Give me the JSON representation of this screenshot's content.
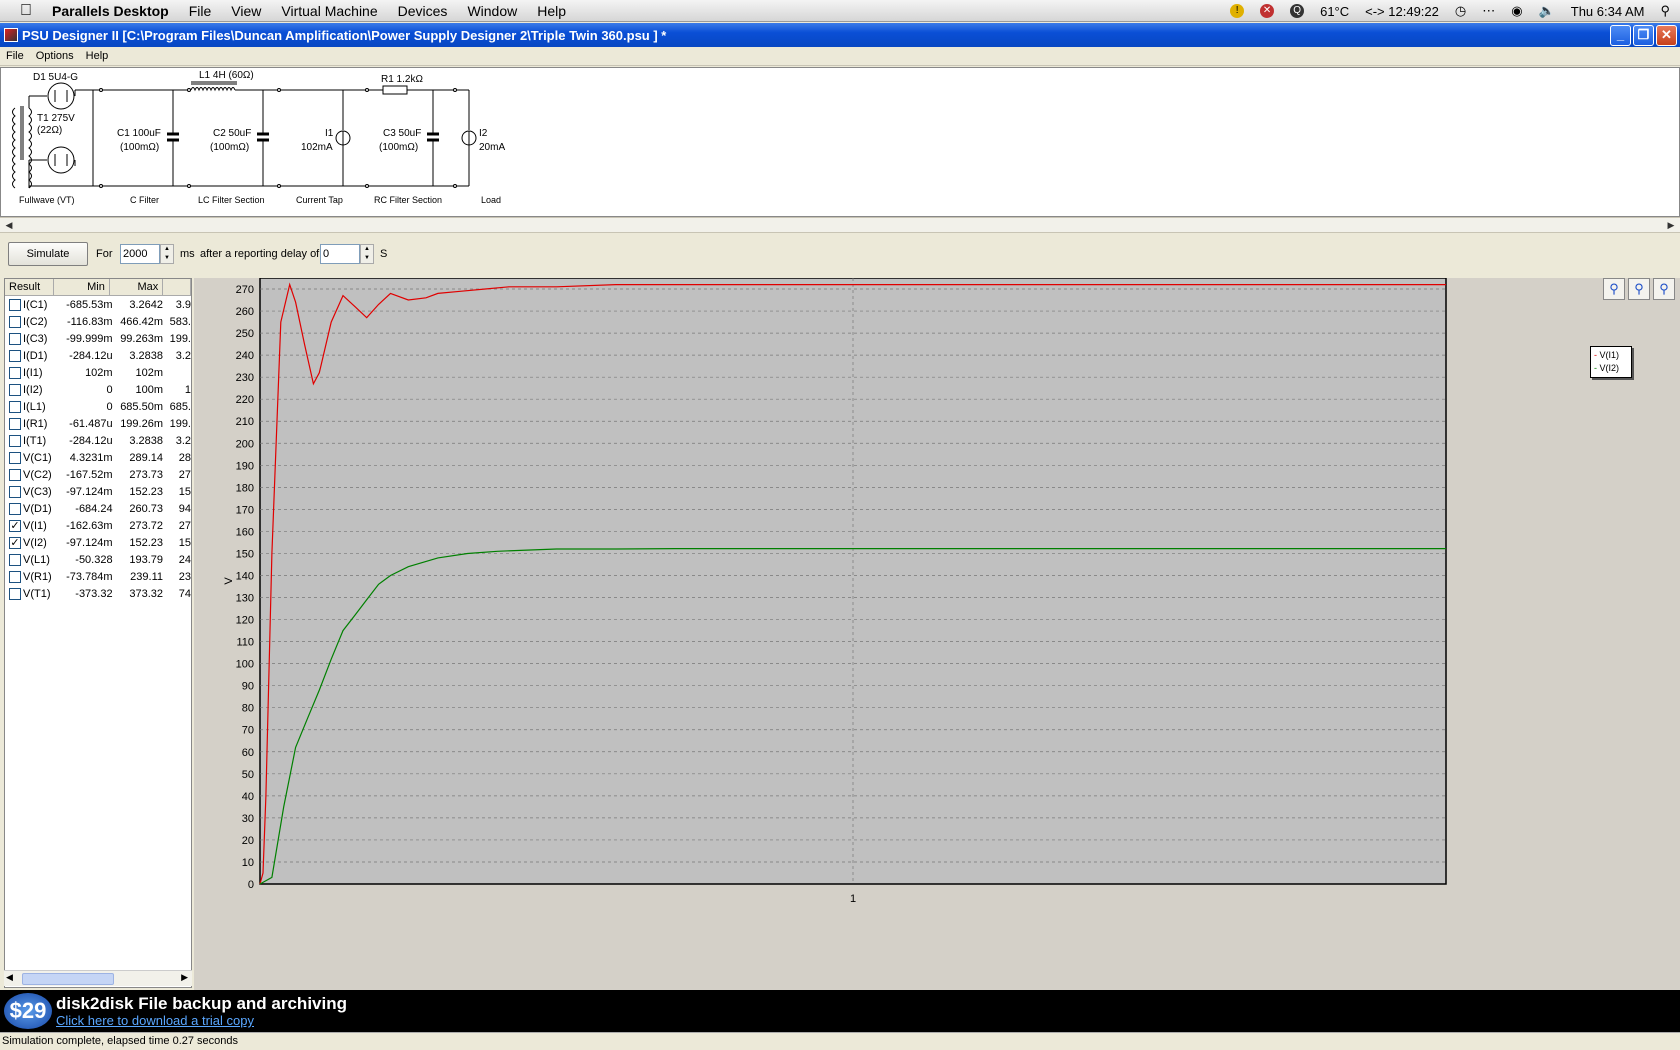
{
  "mac_menubar": {
    "app_name": "Parallels Desktop",
    "items": [
      "File",
      "View",
      "Virtual Machine",
      "Devices",
      "Window",
      "Help"
    ],
    "temperature": "61°C",
    "timer": "12:49:22",
    "clock": "Thu 6:34 AM"
  },
  "window": {
    "title": "PSU Designer II  [C:\\Program Files\\Duncan Amplification\\Power Supply Designer 2\\Triple Twin 360.psu ] *",
    "minimize": "_",
    "maximize": "❐",
    "close": "✕"
  },
  "app_menu": [
    "File",
    "Options",
    "Help"
  ],
  "schematic": {
    "d1": "D1 5U4-G",
    "t1a": "T1 275V",
    "t1b": "(22Ω)",
    "l1": "L1 4H (60Ω)",
    "r1": "R1 1.2kΩ",
    "c1a": "C1 100uF",
    "c1b": "(100mΩ)",
    "c2a": "C2 50uF",
    "c2b": "(100mΩ)",
    "i1a": "I1",
    "i1b": "102mA",
    "c3a": "C3 50uF",
    "c3b": "(100mΩ)",
    "i2a": "I2",
    "i2b": "20mA",
    "sections": [
      "Fullwave (VT)",
      "C Filter",
      "LC Filter Section",
      "Current Tap",
      "RC Filter Section",
      "Load"
    ]
  },
  "toolbar": {
    "simulate_label": "Simulate",
    "for_label": "For",
    "duration": "2000",
    "ms_label": "ms",
    "delay_label": "after a reporting delay of",
    "delay": "0",
    "s_label": "S"
  },
  "results": {
    "headers": [
      "Result",
      "Min",
      "Max",
      ""
    ],
    "rows": [
      {
        "name": "I(C1)",
        "min": "-685.53m",
        "max": "3.2642",
        "extra": "3.9",
        "checked": false
      },
      {
        "name": "I(C2)",
        "min": "-116.83m",
        "max": "466.42m",
        "extra": "583.",
        "checked": false
      },
      {
        "name": "I(C3)",
        "min": "-99.999m",
        "max": "99.263m",
        "extra": "199.",
        "checked": false
      },
      {
        "name": "I(D1)",
        "min": "-284.12u",
        "max": "3.2838",
        "extra": "3.2",
        "checked": false
      },
      {
        "name": "I(I1)",
        "min": "102m",
        "max": "102m",
        "extra": "",
        "checked": false
      },
      {
        "name": "I(I2)",
        "min": "0",
        "max": "100m",
        "extra": "1",
        "checked": false
      },
      {
        "name": "I(L1)",
        "min": "0",
        "max": "685.50m",
        "extra": "685.",
        "checked": false
      },
      {
        "name": "I(R1)",
        "min": "-61.487u",
        "max": "199.26m",
        "extra": "199.",
        "checked": false
      },
      {
        "name": "I(T1)",
        "min": "-284.12u",
        "max": "3.2838",
        "extra": "3.2",
        "checked": false
      },
      {
        "name": "V(C1)",
        "min": "4.3231m",
        "max": "289.14",
        "extra": "28",
        "checked": false
      },
      {
        "name": "V(C2)",
        "min": "-167.52m",
        "max": "273.73",
        "extra": "27",
        "checked": false
      },
      {
        "name": "V(C3)",
        "min": "-97.124m",
        "max": "152.23",
        "extra": "15",
        "checked": false
      },
      {
        "name": "V(D1)",
        "min": "-684.24",
        "max": "260.73",
        "extra": "94",
        "checked": false
      },
      {
        "name": "V(I1)",
        "min": "-162.63m",
        "max": "273.72",
        "extra": "27",
        "checked": true
      },
      {
        "name": "V(I2)",
        "min": "-97.124m",
        "max": "152.23",
        "extra": "15",
        "checked": true
      },
      {
        "name": "V(L1)",
        "min": "-50.328",
        "max": "193.79",
        "extra": "24",
        "checked": false
      },
      {
        "name": "V(R1)",
        "min": "-73.784m",
        "max": "239.11",
        "extra": "23",
        "checked": false
      },
      {
        "name": "V(T1)",
        "min": "-373.32",
        "max": "373.32",
        "extra": "74",
        "checked": false
      }
    ]
  },
  "chart_data": {
    "type": "line",
    "ylabel": "V",
    "xlabel": "",
    "ylim": [
      0,
      275
    ],
    "yticks": [
      0,
      10,
      20,
      30,
      40,
      50,
      60,
      70,
      80,
      90,
      100,
      110,
      120,
      130,
      140,
      150,
      160,
      170,
      180,
      190,
      200,
      210,
      220,
      230,
      240,
      250,
      260,
      270
    ],
    "xlim": [
      0,
      2
    ],
    "xtick_label": "1",
    "grid": true,
    "legend_position": "right",
    "colors": {
      "V(I1)": "#e00000",
      "V(I2)": "#008000"
    },
    "series": [
      {
        "name": "V(I1)",
        "x": [
          0,
          0.005,
          0.01,
          0.02,
          0.035,
          0.05,
          0.06,
          0.075,
          0.09,
          0.1,
          0.12,
          0.14,
          0.16,
          0.18,
          0.2,
          0.22,
          0.25,
          0.28,
          0.3,
          0.34,
          0.38,
          0.42,
          0.5,
          0.6,
          0.8,
          1.0,
          1.4,
          2.0
        ],
        "y": [
          0,
          5,
          40,
          150,
          255,
          272,
          264,
          245,
          227,
          232,
          255,
          267,
          262,
          257,
          263,
          268,
          265,
          266,
          268,
          269,
          270,
          271,
          271,
          272,
          272,
          272,
          272,
          272
        ]
      },
      {
        "name": "V(I2)",
        "x": [
          0,
          0.02,
          0.04,
          0.06,
          0.08,
          0.1,
          0.12,
          0.14,
          0.16,
          0.18,
          0.2,
          0.22,
          0.25,
          0.3,
          0.35,
          0.4,
          0.45,
          0.5,
          0.6,
          0.7,
          0.8,
          1.0,
          1.4,
          2.0
        ],
        "y": [
          0,
          3,
          35,
          62,
          75,
          88,
          102,
          115,
          122,
          129,
          136,
          140,
          144,
          148,
          150,
          151,
          151.5,
          152,
          152,
          152.2,
          152.2,
          152.2,
          152.2,
          152.2
        ]
      }
    ]
  },
  "legend": {
    "i1": "V(I1)",
    "i2": "V(I2)"
  },
  "ad": {
    "price": "$29",
    "title": "disk2disk File backup and archiving",
    "link": "Click here to download a trial copy"
  },
  "status": "Simulation complete, elapsed time 0.27 seconds"
}
